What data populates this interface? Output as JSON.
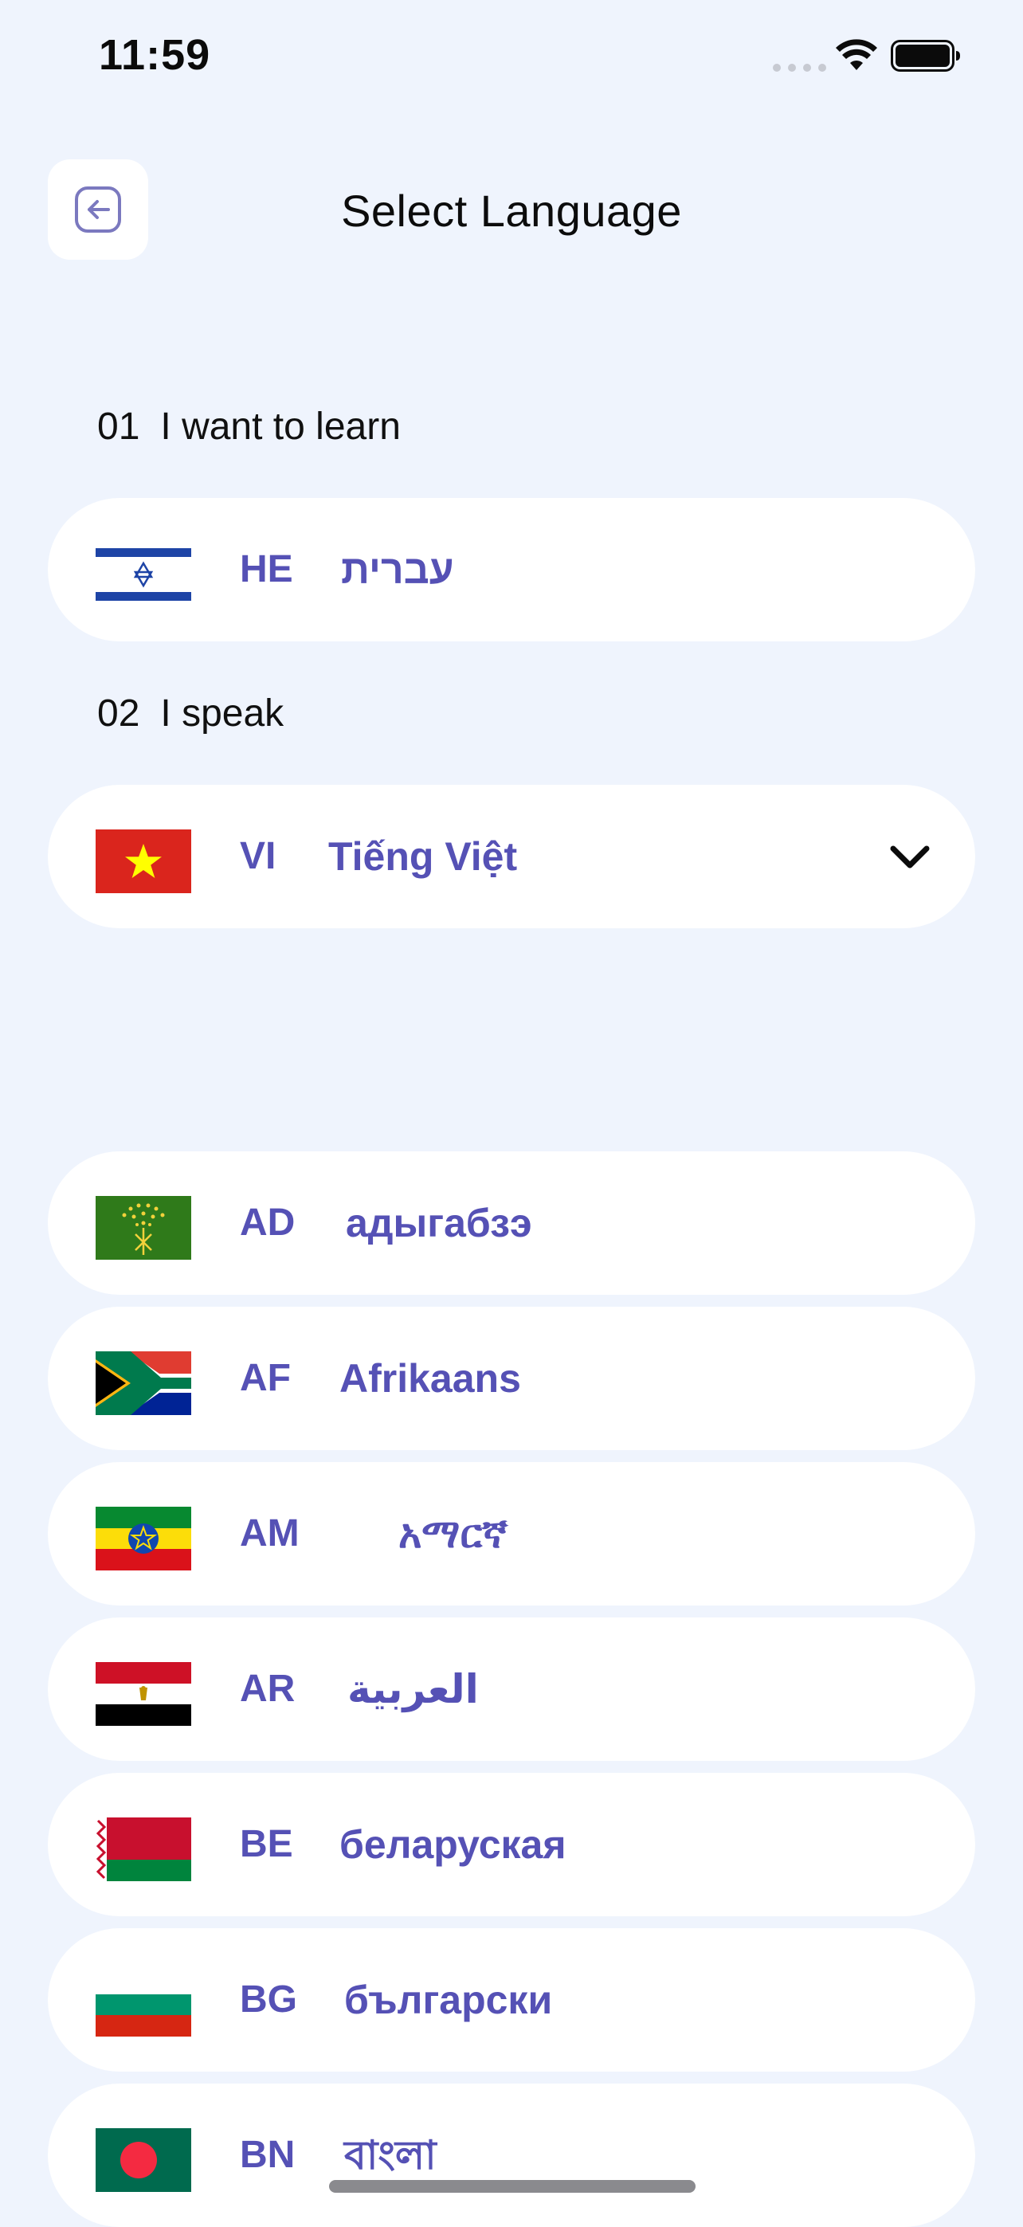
{
  "status_bar": {
    "time": "11:59"
  },
  "header": {
    "title": "Select Language",
    "back_icon": "arrow-left-circle-icon"
  },
  "learn_section": {
    "number": "01",
    "label": "I want to learn",
    "selected": {
      "code": "HE",
      "name": "עברית",
      "flag": "israel-flag-icon"
    }
  },
  "speak_section": {
    "number": "02",
    "label": "I speak",
    "selected": {
      "code": "VI",
      "name": "Tiếng Việt",
      "flag": "vietnam-flag-icon"
    },
    "dropdown_icon": "chevron-down-icon"
  },
  "language_list": [
    {
      "code": "AD",
      "name": "адыгабзэ",
      "flag": "adygea-flag-icon"
    },
    {
      "code": "AF",
      "name": "Afrikaans",
      "flag": "south-africa-flag-icon"
    },
    {
      "code": "AM",
      "name": "አማርኛ",
      "flag": "ethiopia-flag-icon"
    },
    {
      "code": "AR",
      "name": "العربية",
      "flag": "egypt-flag-icon"
    },
    {
      "code": "BE",
      "name": "беларуская",
      "flag": "belarus-flag-icon"
    },
    {
      "code": "BG",
      "name": "български",
      "flag": "bulgaria-flag-icon"
    },
    {
      "code": "BN",
      "name": "বাংলা",
      "flag": "bangladesh-flag-icon"
    }
  ],
  "colors": {
    "background": "#eff4fd",
    "card": "#ffffff",
    "accent_text": "#5551b5"
  }
}
